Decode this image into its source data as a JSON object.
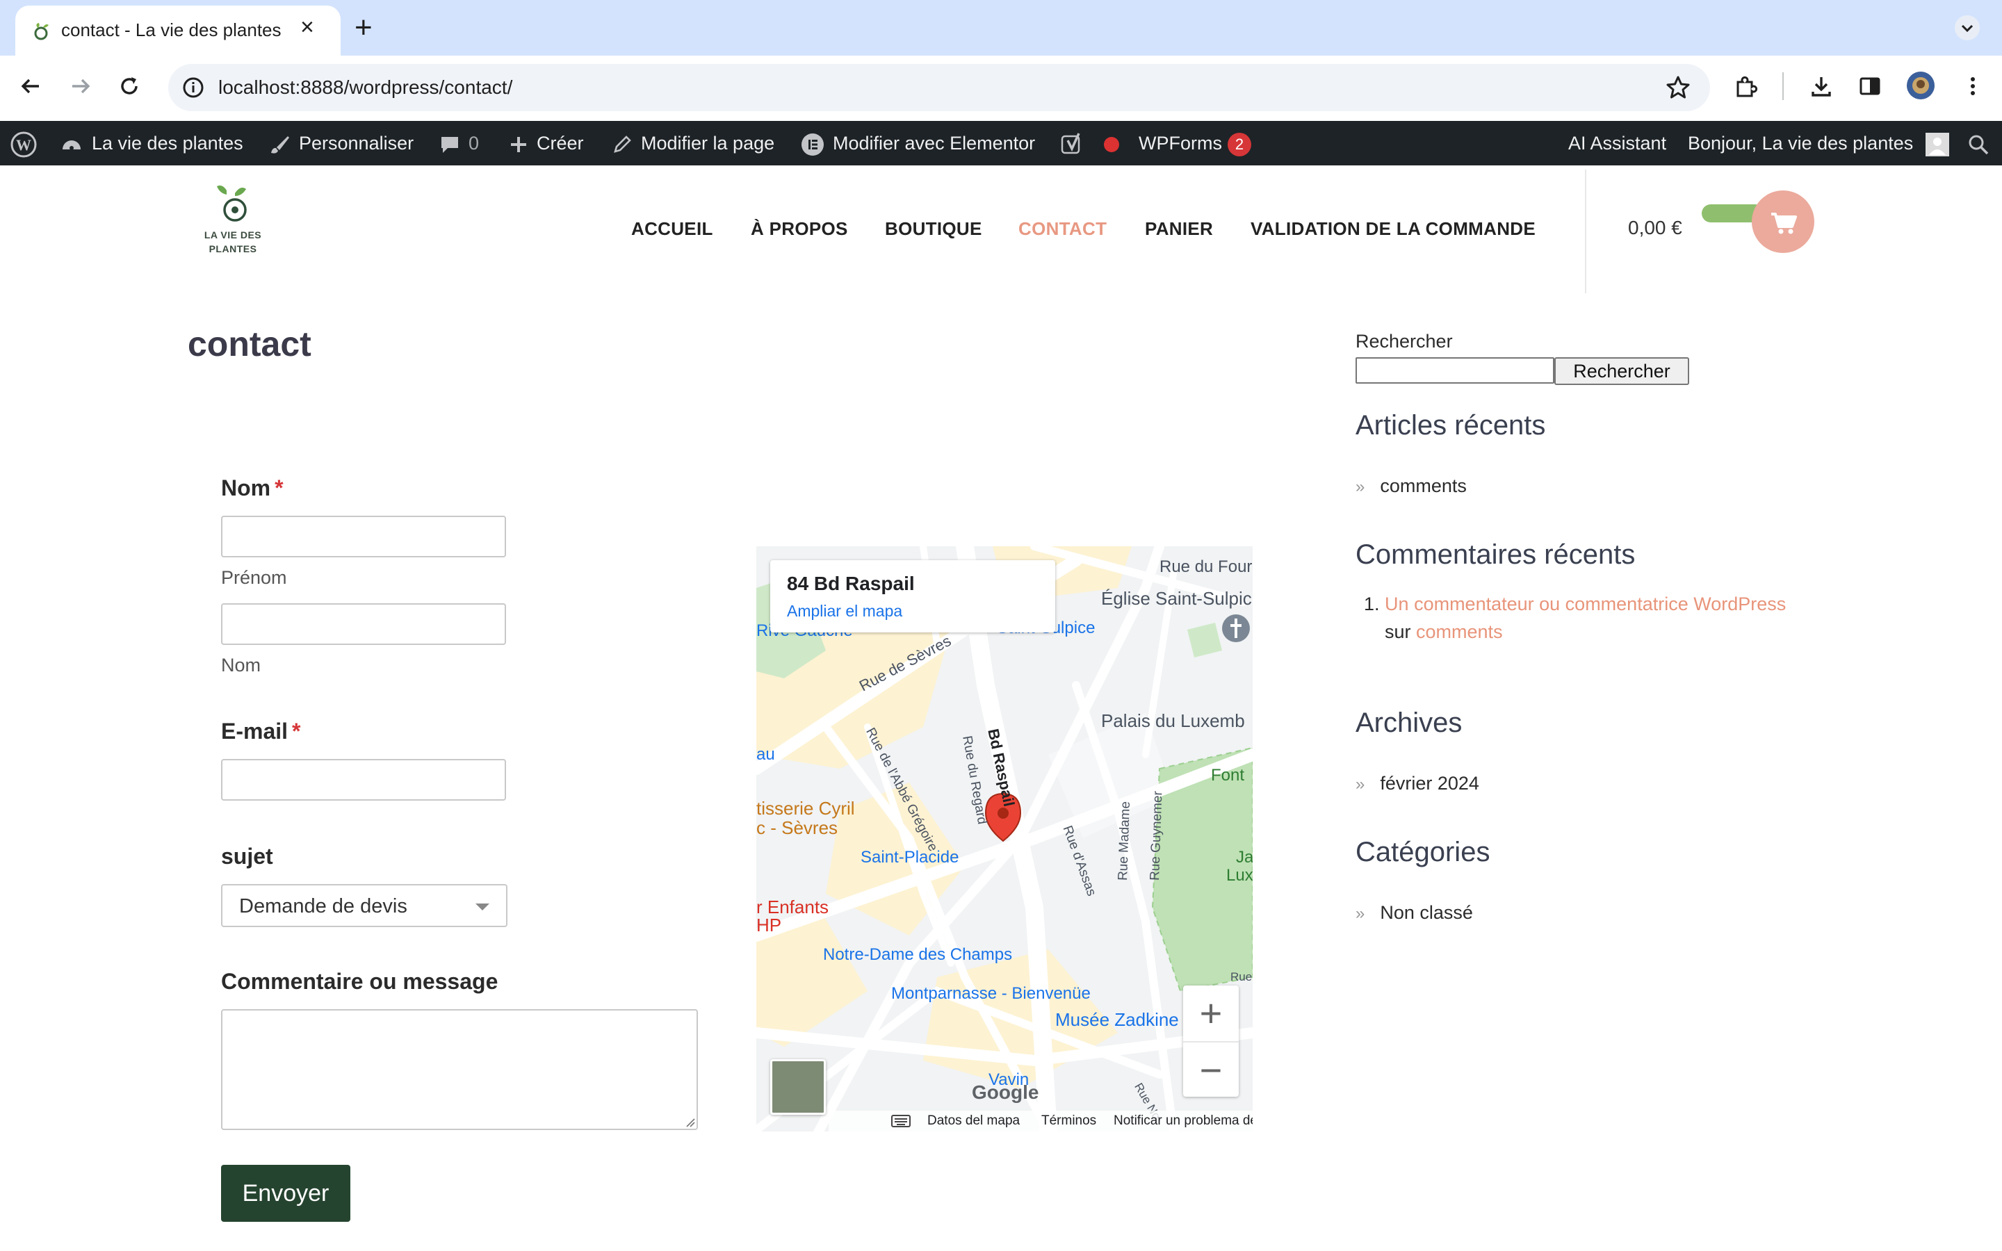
{
  "browser": {
    "tab_title": "contact - La vie des plantes",
    "url": "localhost:8888/wordpress/contact/"
  },
  "adminbar": {
    "site_name": "La vie des plantes",
    "customize": "Personnaliser",
    "comments_count": "0",
    "new": "Créer",
    "edit_page": "Modifier la page",
    "edit_elementor": "Modifier avec Elementor",
    "wpforms": "WPForms",
    "wpforms_badge": "2",
    "ai_assistant": "AI Assistant",
    "greeting": "Bonjour, La vie des plantes"
  },
  "header": {
    "logo_line1": "LA VIE DES",
    "logo_line2": "PLANTES",
    "menu": [
      "ACCUEIL",
      "À PROPOS",
      "BOUTIQUE",
      "CONTACT",
      "PANIER",
      "VALIDATION DE LA COMMANDE"
    ],
    "active_menu": "CONTACT",
    "cart_total": "0,00 €"
  },
  "page": {
    "title": "contact"
  },
  "form": {
    "name_label": "Nom",
    "required_mark": "*",
    "first_name_sub": "Prénom",
    "last_name_sub": "Nom",
    "email_label": "E-mail",
    "subject_label": "sujet",
    "subject_value": "Demande de devis",
    "message_label": "Commentaire ou message",
    "submit": "Envoyer"
  },
  "map": {
    "address": "84 Bd Raspail",
    "enlarge_link": "Ampliar el mapa",
    "labels": [
      "Rue du Four",
      "Église Saint-Sulpic",
      "Saint-Sulpice",
      "Rive Gauche",
      "Rue de Sèvres",
      "Bd Raspail",
      "Rue du Regard",
      "Rue de l'Abbé Grégoire",
      "Palais du Luxemb",
      "Font",
      "au",
      "tisserie Cyril",
      "c - Sèvres",
      "Saint-Placide",
      "Rue d'Assas",
      "Rue Madame",
      "Rue Guynemer",
      "r Enfants",
      "HP",
      "Notre-Dame des Champs",
      "Montparnasse - Bienvenüe",
      "Musée Zadkine",
      "Vavin",
      "Google",
      "Ja",
      "Lux",
      "Rue",
      "Rue No"
    ],
    "footer": [
      "Datos del mapa",
      "Términos",
      "Notificar un problema de Maps"
    ],
    "zoom_in": "+",
    "zoom_out": "−"
  },
  "sidebar": {
    "search_label": "Rechercher",
    "search_button": "Rechercher",
    "recent_posts_title": "Articles récents",
    "recent_posts": [
      "comments"
    ],
    "recent_comments_title": "Commentaires récents",
    "recent_comment_number": "1.",
    "recent_comment_author": "Un commentateur ou commentatrice WordPress",
    "recent_comment_on": "sur",
    "recent_comment_post": "comments",
    "archives_title": "Archives",
    "archives": [
      "février 2024"
    ],
    "categories_title": "Catégories",
    "categories": [
      "Non classé"
    ]
  },
  "colors": {
    "accent": "#e89882",
    "submit_bg": "#25442f",
    "adminbar_bg": "#1d2327",
    "cart_button": "#ebaa9c"
  }
}
